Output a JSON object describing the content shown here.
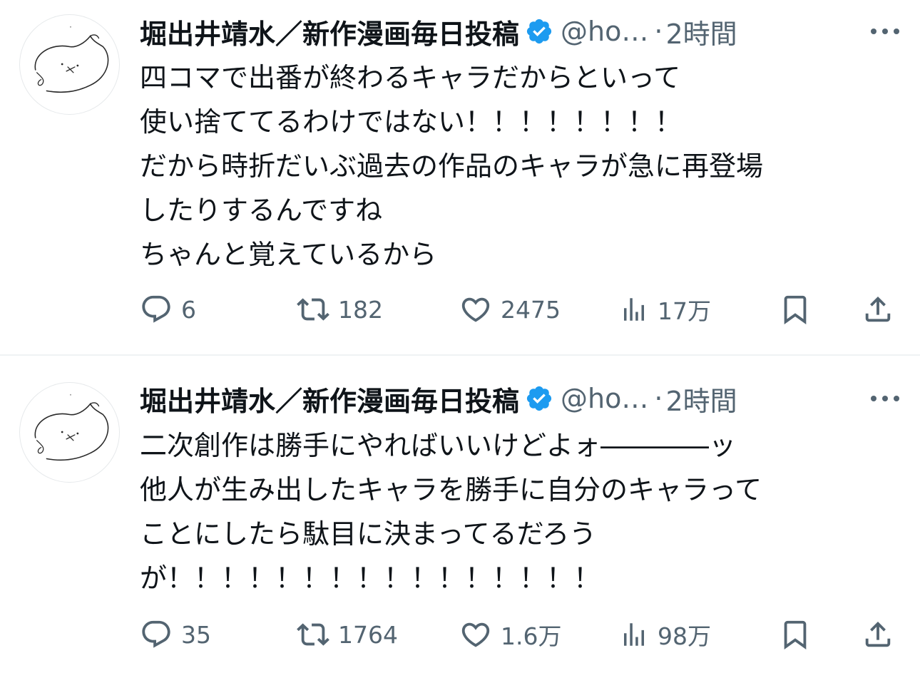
{
  "colors": {
    "text": "#0f1419",
    "secondary": "#536471",
    "verified": "#1d9bf0",
    "divider": "#eff3f4"
  },
  "tweets": [
    {
      "author": {
        "display_name": "堀出井靖水／新作漫画毎日投稿",
        "handle": "@ho…",
        "verified_icon": "verified-badge-icon",
        "avatar": "sketch-cat-avatar"
      },
      "separator": "·",
      "time": "2時間",
      "lines": [
        "四コマで出番が終わるキャラだからといって",
        "使い捨ててるわけではない！！！！！！！！",
        "だから時折だいぶ過去の作品のキャラが急に再登場",
        "したりするんですね",
        "ちゃんと覚えているから"
      ],
      "stats": {
        "replies": "6",
        "retweets": "182",
        "likes": "2475",
        "views": "17万"
      }
    },
    {
      "author": {
        "display_name": "堀出井靖水／新作漫画毎日投稿",
        "handle": "@ho…",
        "verified_icon": "verified-badge-icon",
        "avatar": "sketch-cat-avatar"
      },
      "separator": "·",
      "time": "2時間",
      "lines": [
        "二次創作は勝手にやればいいけどよォ――――ッ",
        "他人が生み出したキャラを勝手に自分のキャラって",
        "ことにしたら駄目に決まってるだろう",
        "が！！！！！！！！！！！！！！！！"
      ],
      "stats": {
        "replies": "35",
        "retweets": "1764",
        "likes": "1.6万",
        "views": "98万"
      }
    }
  ]
}
